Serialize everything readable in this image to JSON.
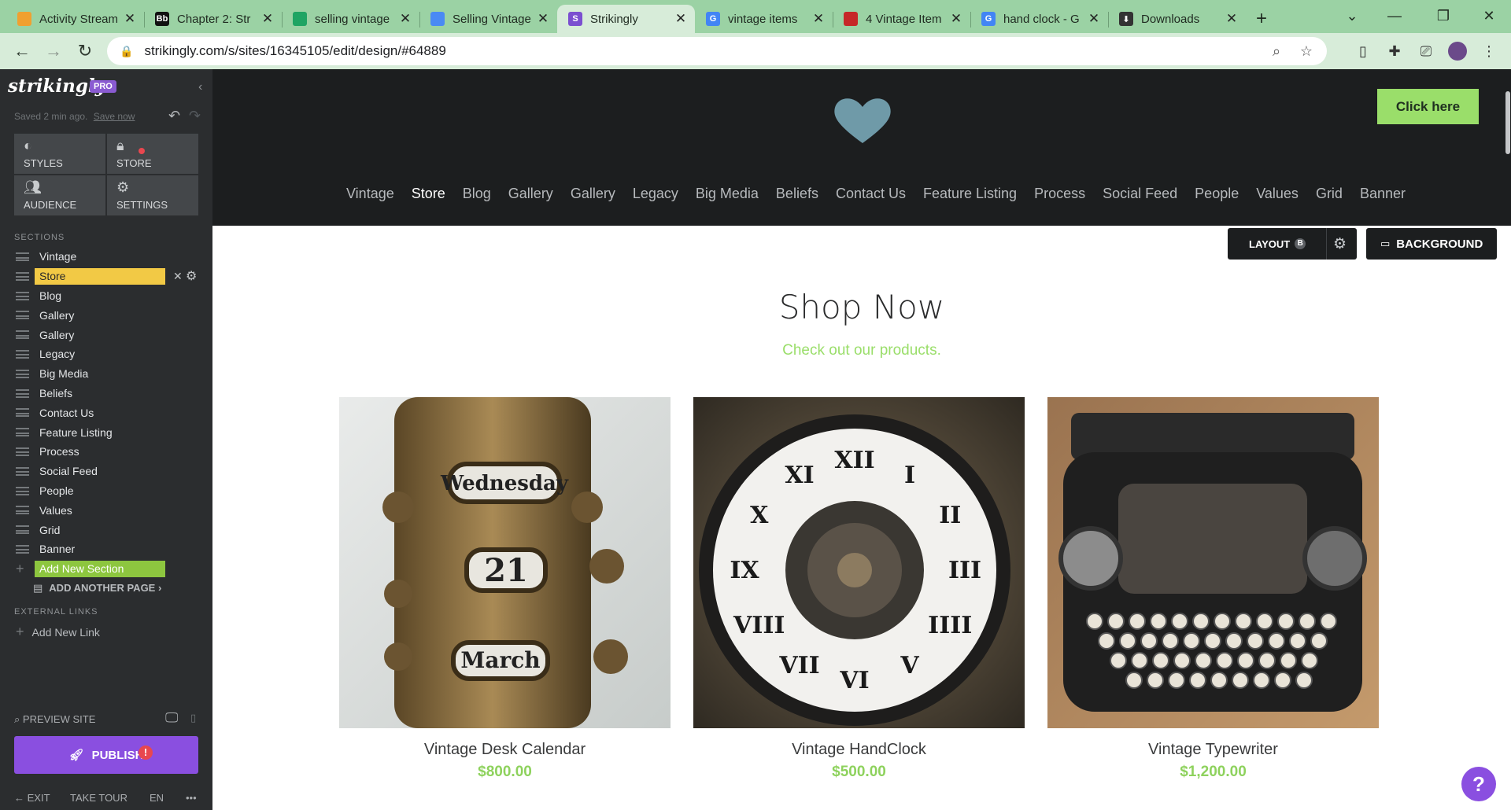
{
  "browser": {
    "tabs": [
      {
        "title": "Activity Stream",
        "favicon_color": "#f0a030",
        "active": false
      },
      {
        "title": "Chapter 2: Str",
        "favicon_color": "#111111",
        "favicon_text": "Bb",
        "active": false
      },
      {
        "title": "selling vintage",
        "favicon_color": "#1fa463",
        "active": false
      },
      {
        "title": "Selling Vintage",
        "favicon_color": "#4a8af4",
        "active": false
      },
      {
        "title": "Strikingly",
        "favicon_color": "#7b4fd0",
        "favicon_text": "S",
        "active": true
      },
      {
        "title": "vintage items",
        "favicon_color": "#4285f4",
        "favicon_text": "G",
        "active": false
      },
      {
        "title": "4 Vintage Item",
        "favicon_color": "#c62828",
        "active": false
      },
      {
        "title": "hand clock - G",
        "favicon_color": "#4285f4",
        "favicon_text": "G",
        "active": false
      },
      {
        "title": "Downloads",
        "favicon_color": "#333333",
        "favicon_text": "⬇",
        "active": false
      }
    ],
    "url": "strikingly.com/s/sites/16345105/edit/design/#64889"
  },
  "sidebar": {
    "logo": "strikingly",
    "badge": "PRO",
    "saved_text": "Saved 2 min ago.",
    "save_now": "Save now",
    "tools": [
      {
        "label": "STYLES",
        "icon": "palette-icon"
      },
      {
        "label": "STORE",
        "icon": "bag-icon"
      },
      {
        "label": "AUDIENCE",
        "icon": "people-icon"
      },
      {
        "label": "SETTINGS",
        "icon": "gear-icon"
      }
    ],
    "sections_heading": "SECTIONS",
    "sections": [
      "Vintage",
      "Store",
      "Blog",
      "Gallery",
      "Gallery",
      "Legacy",
      "Big Media",
      "Beliefs",
      "Contact Us",
      "Feature Listing",
      "Process",
      "Social Feed",
      "People",
      "Values",
      "Grid",
      "Banner"
    ],
    "selected_section": "Store",
    "add_section": "Add New Section",
    "add_page": "ADD ANOTHER PAGE",
    "external_heading": "EXTERNAL LINKS",
    "add_link": "Add New Link",
    "preview": "PREVIEW SITE",
    "publish": "PUBLISH",
    "footer": {
      "exit": "EXIT",
      "tour": "TAKE TOUR",
      "lang": "EN",
      "more": "•••"
    }
  },
  "site": {
    "cta": "Click here",
    "nav": [
      "Vintage",
      "Store",
      "Blog",
      "Gallery",
      "Gallery",
      "Legacy",
      "Big Media",
      "Beliefs",
      "Contact Us",
      "Feature Listing",
      "Process",
      "Social Feed",
      "People",
      "Values",
      "Grid",
      "Banner"
    ],
    "active_nav": "Store",
    "layout_label": "LAYOUT",
    "layout_badge": "B",
    "background_label": "BACKGROUND",
    "title": "Shop Now",
    "subtitle": "Check out our products.",
    "products": [
      {
        "name": "Vintage Desk Calendar",
        "price": "$800.00",
        "day": "Wednesday",
        "date": "21",
        "month": "March"
      },
      {
        "name": "Vintage HandClock",
        "price": "$500.00"
      },
      {
        "name": "Vintage Typewriter",
        "price": "$1,200.00"
      }
    ]
  },
  "colors": {
    "accent_green": "#9ade6a",
    "publish_purple": "#8a4fe0",
    "selected_yellow": "#f2c945",
    "header_dark": "#1c1e1f"
  }
}
